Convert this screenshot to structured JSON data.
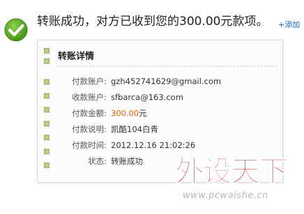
{
  "banner": {
    "check_icon": "check-circle-icon",
    "headline": "转账成功，对方已收到您的300.00元款项。",
    "add_contact": "+添加"
  },
  "details": {
    "title": "转账详情",
    "rows": [
      {
        "label": "付款账户:",
        "value": "gzh452741629@gmail.com"
      },
      {
        "label": "收款账户:",
        "value": "sfbarca@163.com"
      },
      {
        "label": "付款金额:",
        "amount": "300.00",
        "unit": "元"
      },
      {
        "label": "付款说明:",
        "value": "凯酷104白青"
      },
      {
        "label": "付款时间:",
        "value": "2012.12.16 21:02:26"
      },
      {
        "label": "状态:",
        "value": "转账成功"
      }
    ]
  },
  "watermark": {
    "logo_text": "外设天下",
    "url": "www.pcwaishe.cn"
  },
  "colors": {
    "accent_link": "#1a66c4",
    "amount": "#e2630f",
    "check_green": "#54a51d",
    "watermark_red": "#c8161d"
  }
}
